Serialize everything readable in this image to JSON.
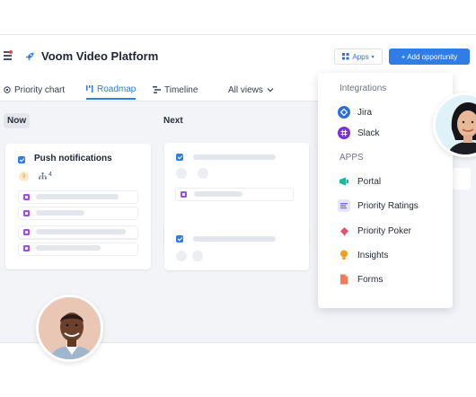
{
  "header": {
    "product_title": "Voom Video Platform",
    "apps_label": "Apps",
    "add_button_label": "+ Add opportunity"
  },
  "tabs": [
    {
      "label": "Priority chart",
      "icon": "target-icon"
    },
    {
      "label": "Roadmap",
      "icon": "roadmap-icon",
      "active": true
    },
    {
      "label": "Timeline",
      "icon": "timeline-icon"
    },
    {
      "label": "All views",
      "icon": "chevron-down-icon"
    }
  ],
  "columns": {
    "now_label": "Now",
    "next_label": "Next"
  },
  "card": {
    "title": "Push notifications",
    "badge": "9",
    "subitem_count": "4"
  },
  "apps_menu": {
    "integrations_heading": "Integrations",
    "integrations": [
      {
        "label": "Jira",
        "icon": "jira-icon",
        "color": "#2f6fd6"
      },
      {
        "label": "Slack",
        "icon": "slack-icon",
        "color": "#7d2fd6"
      }
    ],
    "apps_heading": "APPS",
    "apps": [
      {
        "label": "Portal",
        "icon": "portal-icon",
        "color": "#1fb89a"
      },
      {
        "label": "Priority Ratings",
        "icon": "ratings-icon",
        "color": "#7b6fe0"
      },
      {
        "label": "Priority Poker",
        "icon": "poker-icon",
        "color": "#e5506e"
      },
      {
        "label": "Insights",
        "icon": "insights-icon",
        "color": "#f2a01b"
      },
      {
        "label": "Forms",
        "icon": "forms-icon",
        "color": "#f07a5a"
      }
    ]
  },
  "colors": {
    "accent": "#2f7de5",
    "subtask": "#9b51e0"
  }
}
